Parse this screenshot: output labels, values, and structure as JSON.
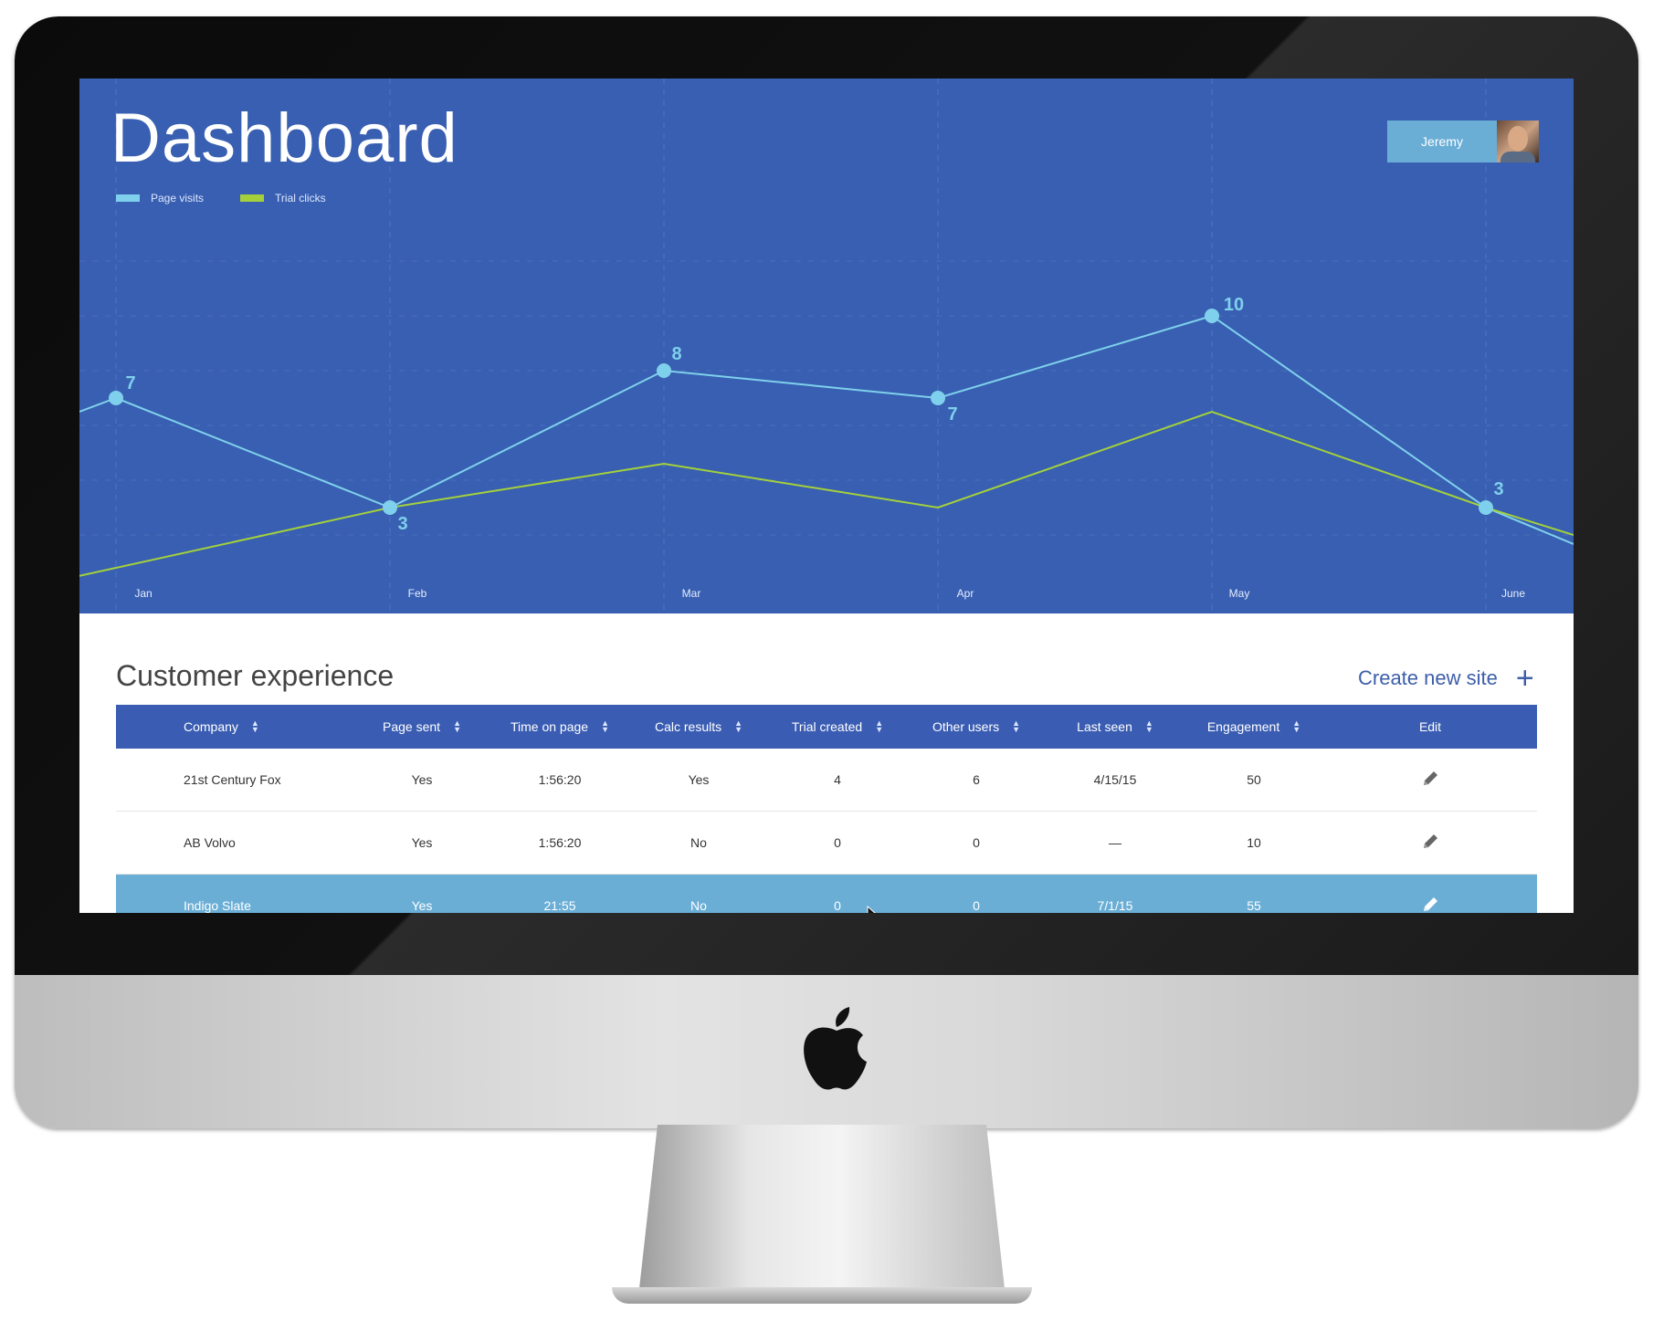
{
  "app": {
    "title": "Dashboard",
    "user": {
      "name": "Jeremy"
    }
  },
  "legend": [
    {
      "label": "Page visits",
      "color": "#7fd0ec"
    },
    {
      "label": "Trial clicks",
      "color": "#a4d13b"
    }
  ],
  "chart_data": {
    "type": "line",
    "categories": [
      "Jan",
      "Feb",
      "Mar",
      "Apr",
      "May",
      "June"
    ],
    "ylim": [
      0,
      14
    ],
    "grid": true,
    "legend_placement": "top-left",
    "series": [
      {
        "name": "Page visits",
        "color": "#7fd0ec",
        "values": [
          7,
          3,
          8,
          7,
          10,
          3
        ],
        "labels": [
          "7",
          "3",
          "8",
          "7",
          "10",
          "3"
        ]
      },
      {
        "name": "Trial clicks",
        "color": "#a4d13b",
        "values": [
          0.8,
          3,
          4.6,
          3,
          6.5,
          3
        ]
      }
    ]
  },
  "section": {
    "title": "Customer experience",
    "create_label": "Create new site"
  },
  "table": {
    "columns": [
      "Company",
      "Page sent",
      "Time on page",
      "Calc results",
      "Trial created",
      "Other users",
      "Last seen",
      "Engagement",
      "Edit"
    ],
    "rows": [
      {
        "company": "21st Century Fox",
        "page_sent": "Yes",
        "time_on_page": "1:56:20",
        "calc_results": "Yes",
        "trial_created": "4",
        "other_users": "6",
        "last_seen": "4/15/15",
        "engagement": "50",
        "selected": false
      },
      {
        "company": "AB Volvo",
        "page_sent": "Yes",
        "time_on_page": "1:56:20",
        "calc_results": "No",
        "trial_created": "0",
        "other_users": "0",
        "last_seen": "—",
        "engagement": "10",
        "selected": false
      },
      {
        "company": "Indigo Slate",
        "page_sent": "Yes",
        "time_on_page": "21:55",
        "calc_results": "No",
        "trial_created": "0",
        "other_users": "0",
        "last_seen": "7/1/15",
        "engagement": "55",
        "selected": true
      }
    ]
  },
  "colors": {
    "hero_bg": "#385fb1",
    "header_bg": "#3a5db3",
    "selected_row": "#6aaed6",
    "accent": "#3d5ea9"
  }
}
